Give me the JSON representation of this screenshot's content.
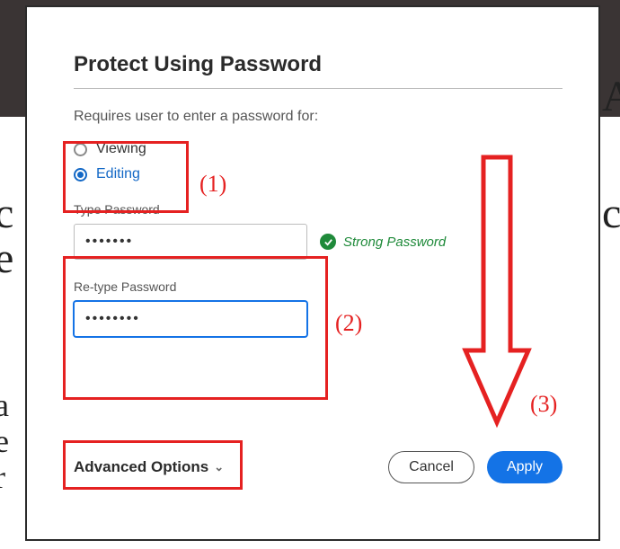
{
  "dialog": {
    "title": "Protect Using Password",
    "subtitle": "Requires user to enter a password for:",
    "options": {
      "viewing": "Viewing",
      "editing": "Editing",
      "selected": "editing"
    },
    "password": {
      "label": "Type Password",
      "value": "•••••••",
      "strength_text": "Strong Password"
    },
    "retype": {
      "label": "Re-type Password",
      "value": "••••••••"
    },
    "advanced_label": "Advanced Options",
    "buttons": {
      "cancel": "Cancel",
      "apply": "Apply"
    }
  },
  "annotations": {
    "label1": "(1)",
    "label2": "(2)",
    "label3": "(3)"
  }
}
